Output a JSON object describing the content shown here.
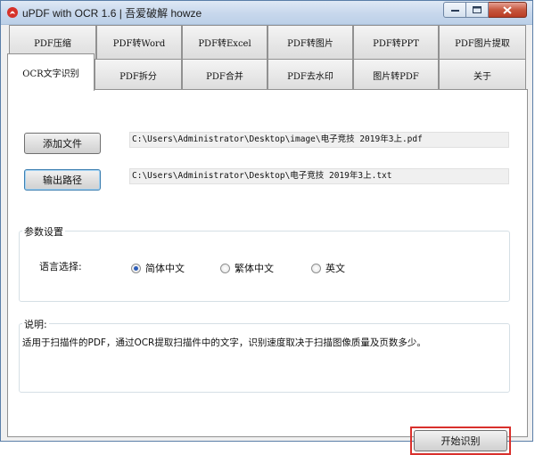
{
  "window": {
    "title": "uPDF with OCR 1.6 |  吾爱破解 howze"
  },
  "tabs_row1": [
    "PDF压缩",
    "PDF转Word",
    "PDF转Excel",
    "PDF转图片",
    "PDF转PPT",
    "PDF图片提取"
  ],
  "tabs_row2": [
    "OCR文字识别",
    "PDF拆分",
    "PDF合并",
    "PDF去水印",
    "图片转PDF",
    "关于"
  ],
  "active_tab": "OCR文字识别",
  "files": {
    "add_button": "添加文件",
    "input_path": "C:\\Users\\Administrator\\Desktop\\image\\电子竞技 2019年3上.pdf",
    "output_button": "输出路径",
    "output_path": "C:\\Users\\Administrator\\Desktop\\电子竞技 2019年3上.txt"
  },
  "params": {
    "group_label": "参数设置",
    "language_label": "语言选择:",
    "options": [
      "简体中文",
      "繁体中文",
      "英文"
    ],
    "selected": "简体中文"
  },
  "note": {
    "group_label": "说明:",
    "text": "适用于扫描件的PDF，通过OCR提取扫描件中的文字，识别速度取决于扫描图像质量及页数多少。"
  },
  "start_button": "开始识别"
}
